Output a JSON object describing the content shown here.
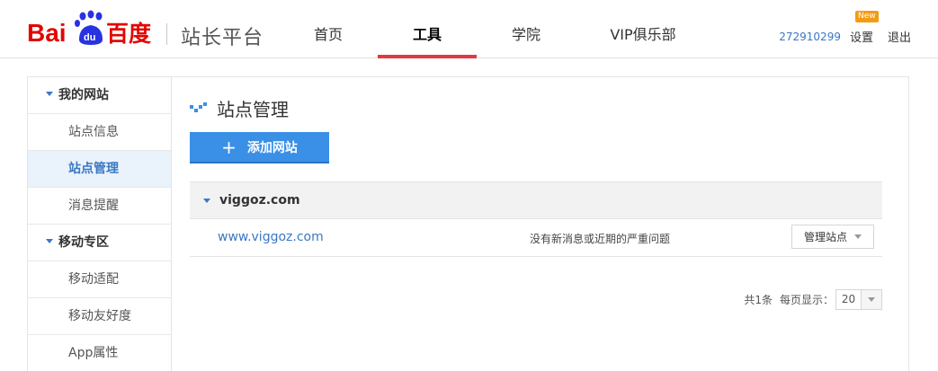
{
  "header": {
    "logo_text": "Bai百度",
    "site_title": "站长平台",
    "nav": [
      {
        "label": "首页",
        "active": false
      },
      {
        "label": "工具",
        "active": true
      },
      {
        "label": "学院",
        "active": false
      },
      {
        "label": "VIP俱乐部",
        "active": false
      }
    ],
    "user_id": "272910299",
    "settings_label": "设置",
    "new_badge": "New",
    "logout_label": "退出"
  },
  "sidebar": {
    "groups": [
      {
        "label": "我的网站",
        "items": [
          "站点信息",
          "站点管理",
          "消息提醒"
        ]
      },
      {
        "label": "移动专区",
        "items": [
          "移动适配",
          "移动友好度",
          "App属性"
        ]
      }
    ],
    "active_item": "站点管理"
  },
  "main": {
    "title": "站点管理",
    "add_button": "添加网站",
    "site_group": "viggoz.com",
    "rows": [
      {
        "url": "www.viggoz.com",
        "status": "没有新消息或近期的严重问题",
        "action": "管理站点"
      }
    ],
    "pager": {
      "count": "共1条",
      "per_page_label": "每页显示：",
      "per_page_value": "20"
    }
  },
  "colors": {
    "accent_blue": "#3a8fe6",
    "link_blue": "#3a78c3",
    "nav_active_red": "#e4393c",
    "badge_orange": "#f39c12"
  }
}
